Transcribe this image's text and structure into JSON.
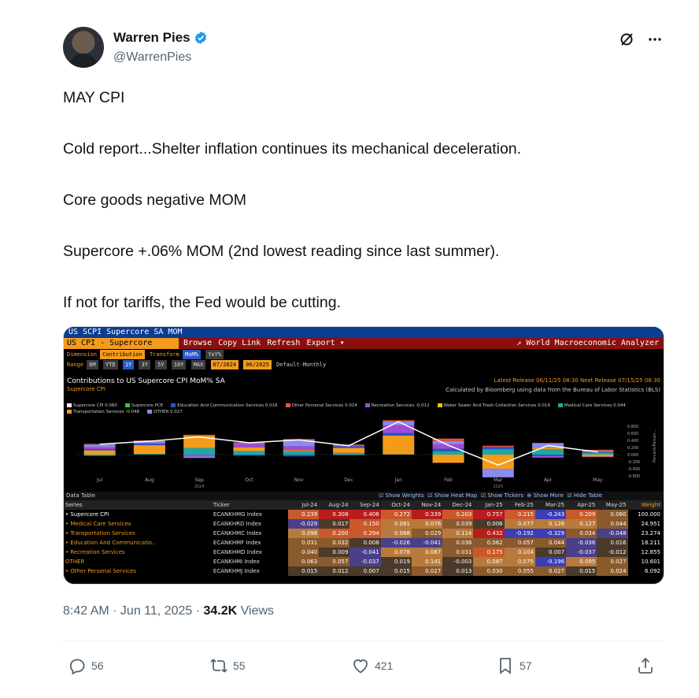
{
  "author": {
    "name": "Warren Pies",
    "handle": "@WarrenPies"
  },
  "tweet": {
    "paragraphs": [
      "MAY CPI",
      "Cold report...Shelter inflation continues its mechanical deceleration.",
      "Core goods negative MOM",
      "Supercore +.06% MOM (2nd lowest reading since last summer).",
      "If not for tariffs, the Fed would be cutting."
    ]
  },
  "media": {
    "window_title": "US SCPI Supercore SA MOM",
    "security": "US CPI - Supercore",
    "menu": [
      "Browse",
      "Copy Link",
      "Refresh",
      "Export ▾"
    ],
    "app_name": "World Macroeconomic Analyzer",
    "dimension_label": "Dimension",
    "dimension_value": "Contribution",
    "transform_label": "Transform",
    "transform_options": [
      "MoM%",
      "YoY%"
    ],
    "range_label": "Range",
    "range_options": [
      "6M",
      "YTD",
      "1Y",
      "3Y",
      "5Y",
      "10Y",
      "MAX"
    ],
    "range_start": "07/2024",
    "range_end": "06/2025",
    "frequency": "Default-Monthly",
    "chart_title": "Contributions to US Supercore CPI MoM% SA",
    "chart_subtitle": "Supercore CPI",
    "latest_release": "Latest Release 06/11/25 08:30  Next Release 07/15/25 08:30",
    "calc_note": "Calculated by Bloomberg using data from the Bureau of Labor Statistics (BLS)",
    "legend": [
      {
        "label": "Supercore CPI  0.060",
        "color": "#ffffff"
      },
      {
        "label": "Supercore PCE",
        "color": "#2ecc40"
      },
      {
        "label": "Education And Communication Services 0.016",
        "color": "#2a56c6"
      },
      {
        "label": "Other Personal Services 0.024",
        "color": "#e8553a"
      },
      {
        "label": "Recreation Services -0.012",
        "color": "#a24ad6"
      },
      {
        "label": "Water Sewer And Trash Collection Services 0.019",
        "color": "#f5c400"
      },
      {
        "label": "Medical Care Services 0.044",
        "color": "#1fa8a0"
      },
      {
        "label": "Transportation Services -0.048",
        "color": "#f59b1c"
      },
      {
        "label": "OTHER  0.027",
        "color": "#8a8af0"
      }
    ],
    "data_table_label": "Data Table",
    "toolbar": [
      "Show Weights",
      "Show Heat Map",
      "Show Tickers",
      "Show More",
      "Hide Table"
    ],
    "col_series": "Series",
    "col_ticker": "Ticker",
    "col_weight": "Weight",
    "months": [
      "Jul-24",
      "Aug-24",
      "Sep-24",
      "Oct-24",
      "Nov-24",
      "Dec-24",
      "Jan-25",
      "Feb-25",
      "Mar-25",
      "Apr-25",
      "May-25"
    ],
    "rows": [
      {
        "series": "• Supercore CPI",
        "ticker": "ECANKHMG Index",
        "values": [
          "0.239",
          "0.308",
          "0.406",
          "0.272",
          "0.339",
          "0.203",
          "0.757",
          "0.215",
          "-0.243",
          "0.209",
          "0.060"
        ],
        "weight": "100.000"
      },
      {
        "series": "• Medical Care Services",
        "ticker": "ECANKHRD Index",
        "values": [
          "-0.029",
          "0.017",
          "0.150",
          "0.081",
          "0.076",
          "0.039",
          "0.006",
          "0.077",
          "0.126",
          "0.127",
          "0.044"
        ],
        "weight": "24.951"
      },
      {
        "series": "• Transportation Services",
        "ticker": "ECANKHMC Index",
        "values": [
          "0.098",
          "0.200",
          "0.294",
          "0.088",
          "0.029",
          "0.114",
          "0.432",
          "-0.192",
          "-0.329",
          "0.034",
          "-0.048"
        ],
        "weight": "23.274"
      },
      {
        "series": "• Education And Communicatio..",
        "ticker": "ECANKHMF Index",
        "values": [
          "0.031",
          "0.032",
          "0.008",
          "-0.026",
          "-0.041",
          "0.036",
          "0.062",
          "0.057",
          "0.044",
          "-0.036",
          "0.016"
        ],
        "weight": "18.211"
      },
      {
        "series": "• Recreation Services",
        "ticker": "ECANKHMD Index",
        "values": [
          "0.040",
          "0.009",
          "-0.041",
          "0.078",
          "0.087",
          "0.031",
          "0.175",
          "0.104",
          "0.007",
          "-0.037",
          "-0.012"
        ],
        "weight": "12.855"
      },
      {
        "series": "OTHER",
        "ticker": "ECANKHMI Index",
        "values": [
          "0.063",
          "0.057",
          "-0.037",
          "0.019",
          "0.141",
          "-0.003",
          "0.087",
          "0.075",
          "-0.196",
          "0.095",
          "0.027"
        ],
        "weight": "10.601"
      },
      {
        "series": "• Other Personal Services",
        "ticker": "ECANKHMJ Index",
        "values": [
          "0.015",
          "0.012",
          "0.007",
          "0.015",
          "0.027",
          "0.013",
          "0.030",
          "0.055",
          "0.027",
          "0.015",
          "0.024"
        ],
        "weight": "6.092"
      }
    ],
    "chart_x_labels": [
      "Jul",
      "Aug",
      "Sep",
      "Oct",
      "Nov",
      "Dec",
      "Jan",
      "Feb",
      "Mar",
      "Apr",
      "May"
    ],
    "chart_year_labels": [
      "2024",
      "2025"
    ],
    "y_axis_label": "Percent/Percen...",
    "y_ticks": [
      "0.800",
      "0.600",
      "0.400",
      "0.200",
      "0.060",
      "-0.200",
      "-0.400",
      "-0.600"
    ]
  },
  "meta": {
    "time": "8:42 AM · Jun 11, 2025 · ",
    "views_count": "34.2K",
    "views_label": " Views"
  },
  "actions": {
    "replies": "56",
    "reposts": "55",
    "likes": "421",
    "bookmarks": "57"
  }
}
